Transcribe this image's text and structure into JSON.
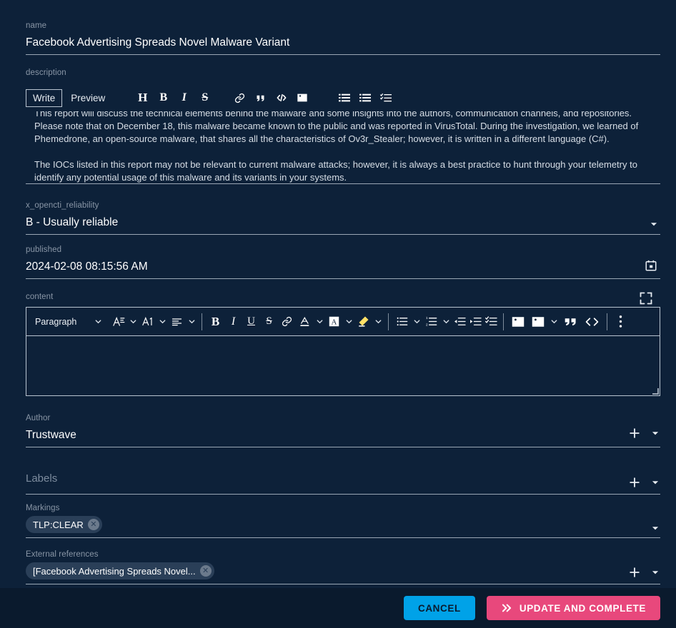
{
  "form": {
    "name": {
      "label": "name",
      "value": "Facebook Advertising Spreads Novel Malware Variant"
    },
    "description": {
      "label": "description",
      "tabs": [
        {
          "label": "Write",
          "active": true
        },
        {
          "label": "Preview",
          "active": false
        }
      ],
      "toolbar_icons": [
        "heading-icon",
        "bold-icon",
        "italic-icon",
        "strikethrough-icon",
        "link-icon",
        "blockquote-icon",
        "code-icon",
        "image-icon",
        "bulleted-list-icon",
        "numbered-list-icon",
        "task-list-icon"
      ],
      "paragraphs": [
        "This report will discuss the technical elements behind the malware and some insights into the authors, communication channels, and repositories. Please note that on December 18, this malware became known to the public and was reported in VirusTotal. During the investigation, we learned of Phemedrone, an open-source malware, that shares all the characteristics of Ov3r_Stealer; however, it is written in a different language (C#).",
        "The IOCs listed in this report may not be relevant to current malware attacks; however, it is always a best practice to hunt through your telemetry to identify any potential usage of this malware and its variants in your systems."
      ]
    },
    "reliability": {
      "label": "x_opencti_reliability",
      "value": "B - Usually reliable"
    },
    "published": {
      "label": "published",
      "value": "2024-02-08 08:15:56 AM",
      "icon": "calendar-icon"
    },
    "content": {
      "label": "content",
      "expand_icon": "fullscreen-icon",
      "value": "",
      "toolbar": {
        "paragraph_style": "Paragraph",
        "buttons": [
          "font-size-icon",
          "font-family-icon",
          "alignment-icon",
          "bold-icon",
          "italic-icon",
          "underline-icon",
          "strikethrough-icon",
          "link-icon",
          "font-color-icon",
          "background-color-icon",
          "highlight-icon",
          "bulleted-list-icon",
          "numbered-list-icon",
          "outdent-icon",
          "indent-icon",
          "todo-list-icon",
          "insert-image-icon",
          "image-upload-icon",
          "block-quote-icon",
          "code-block-icon",
          "more-options-icon"
        ]
      }
    },
    "author": {
      "label": "Author",
      "value": "Trustwave",
      "add_icon": "plus-icon",
      "dropdown_icon": "arrow-drop-down-icon"
    },
    "labels": {
      "label": "Labels",
      "value": "",
      "add_icon": "plus-icon",
      "dropdown_icon": "arrow-drop-down-icon"
    },
    "markings": {
      "label": "Markings",
      "chips": [
        {
          "text": "TLP:CLEAR",
          "remove_icon": "chip-delete-icon"
        }
      ],
      "dropdown_icon": "arrow-drop-down-icon"
    },
    "external_references": {
      "label": "External references",
      "chips": [
        {
          "text": "[Facebook Advertising Spreads Novel...",
          "remove_icon": "chip-delete-icon"
        }
      ],
      "add_icon": "plus-icon",
      "dropdown_icon": "arrow-drop-down-icon"
    }
  },
  "footer": {
    "cancel_label": "CANCEL",
    "complete_label": "UPDATE AND COMPLETE",
    "complete_icon": "double-chevron-right-icon"
  },
  "colors": {
    "background": "#0d2139",
    "footer_background": "#0a1a2d",
    "cancel": "#00a2e8",
    "complete": "#e8487c",
    "label": "#8996a6",
    "underline": "#9aa7b5",
    "chip": "#2a3f58",
    "spellcheck": "#e03030",
    "highlight_pen": "#ffe066"
  }
}
